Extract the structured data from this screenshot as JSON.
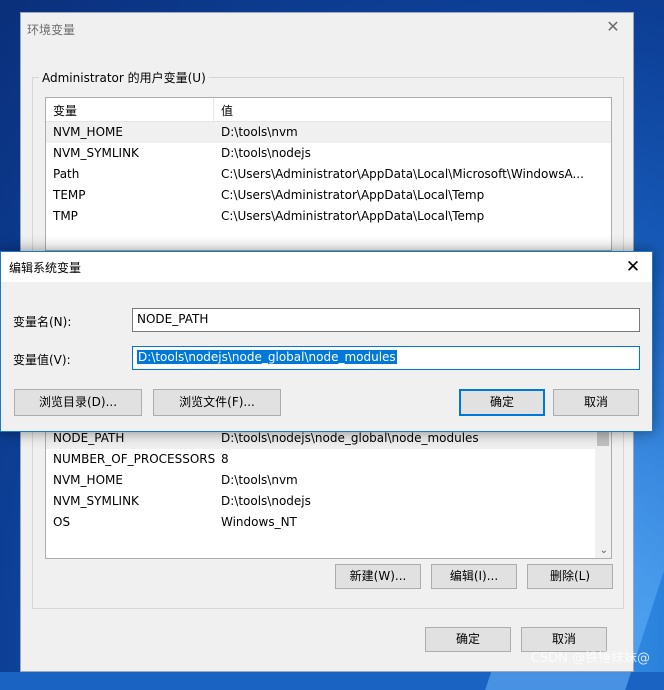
{
  "env_window": {
    "title": "环境变量",
    "user_group_label": "Administrator 的用户变量(U)",
    "columns": [
      "变量",
      "值"
    ],
    "user_vars": [
      {
        "name": "NVM_HOME",
        "value": "D:\\tools\\nvm"
      },
      {
        "name": "NVM_SYMLINK",
        "value": "D:\\tools\\nodejs"
      },
      {
        "name": "Path",
        "value": "C:\\Users\\Administrator\\AppData\\Local\\Microsoft\\WindowsA..."
      },
      {
        "name": "TEMP",
        "value": "C:\\Users\\Administrator\\AppData\\Local\\Temp"
      },
      {
        "name": "TMP",
        "value": "C:\\Users\\Administrator\\AppData\\Local\\Temp"
      }
    ],
    "sys_vars": [
      {
        "name": "NODE_PATH",
        "value": "D:\\tools\\nodejs\\node_global\\node_modules"
      },
      {
        "name": "NUMBER_OF_PROCESSORS",
        "value": "8"
      },
      {
        "name": "NVM_HOME",
        "value": "D:\\tools\\nvm"
      },
      {
        "name": "NVM_SYMLINK",
        "value": "D:\\tools\\nodejs"
      },
      {
        "name": "OS",
        "value": "Windows_NT"
      }
    ],
    "sys_buttons": {
      "new": "新建(W)...",
      "edit": "编辑(I)...",
      "delete": "删除(L)"
    },
    "ok": "确定",
    "cancel": "取消"
  },
  "dialog": {
    "title": "编辑系统变量",
    "name_label": "变量名(N):",
    "name_value": "NODE_PATH",
    "value_label": "变量值(V):",
    "value_value": "D:\\tools\\nodejs\\node_global\\node_modules",
    "browse_dir": "浏览目录(D)...",
    "browse_file": "浏览文件(F)...",
    "ok": "确定",
    "cancel": "取消"
  },
  "watermark": "CSDN @铁锤妹妹@"
}
